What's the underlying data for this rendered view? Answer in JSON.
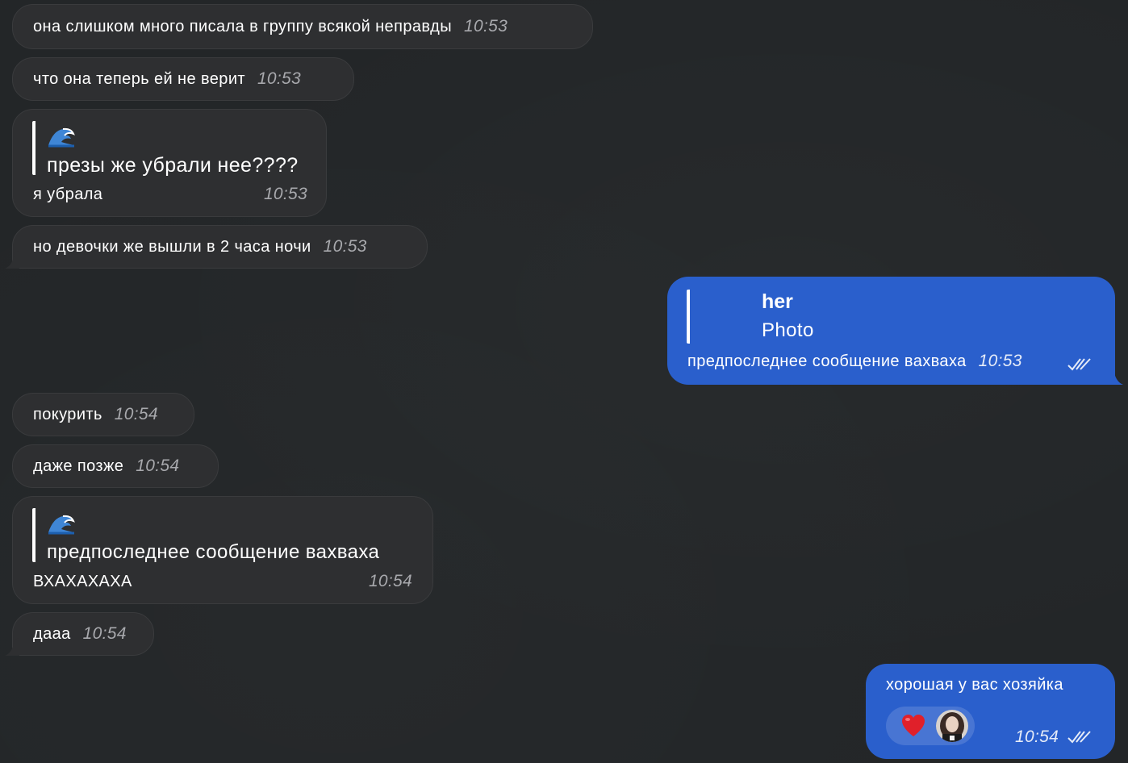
{
  "colors": {
    "background": "#232628",
    "incoming_bubble": "#2e2f31",
    "outgoing_bubble": "#2a5fcc",
    "time_incoming": "#a8a9ad",
    "time_outgoing": "#e6ecf8",
    "heart": "#e0202a"
  },
  "messages": [
    {
      "text": "она слишком много писала в группу всякой неправды",
      "time": "10:53"
    },
    {
      "text": "что она теперь ей не верит",
      "time": "10:53"
    },
    {
      "quote_icon": "wave-emoji-icon",
      "quote_text": "презы же убрали нее????",
      "text": "я убрала",
      "time": "10:53"
    },
    {
      "text": "но девочки же вышли в 2 часа ночи",
      "time": "10:53"
    },
    {
      "quote_name": "her",
      "quote_text": "Photo",
      "text": "предпоследнее сообщение вахваха",
      "time": "10:53",
      "status": "read"
    },
    {
      "text": "покурить",
      "time": "10:54"
    },
    {
      "text": "даже позже",
      "time": "10:54"
    },
    {
      "quote_icon": "wave-emoji-icon",
      "quote_text": "предпоследнее сообщение вахваха",
      "text": "ВХАХАХАХА",
      "time": "10:54"
    },
    {
      "text": "дааа",
      "time": "10:54"
    },
    {
      "text": "хорошая у вас хозяйка",
      "time": "10:54",
      "status": "read",
      "reaction": "heart-emoji-icon"
    }
  ]
}
